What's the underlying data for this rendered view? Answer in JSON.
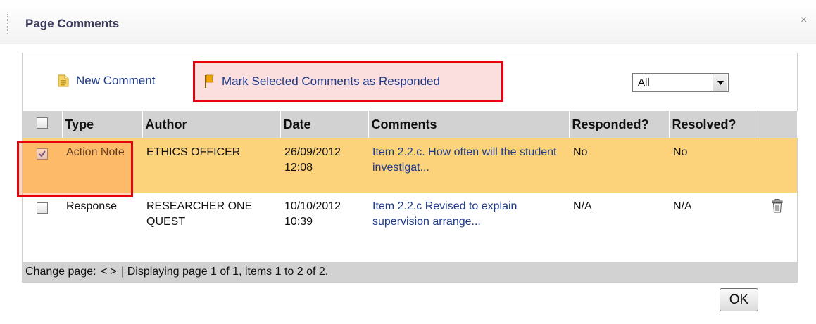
{
  "dialog": {
    "title": "Page Comments",
    "close_glyph": "×"
  },
  "toolbar": {
    "new_comment_label": "New Comment",
    "mark_responded_label": "Mark Selected Comments as Responded",
    "filter": {
      "selected": "All"
    }
  },
  "table": {
    "columns": [
      "Type",
      "Author",
      "Date",
      "Comments",
      "Responded?",
      "Resolved?"
    ],
    "rows": [
      {
        "checked": true,
        "type": "Action Note",
        "author": "ETHICS OFFICER",
        "date": "26/09/2012 12:08",
        "comment": "Item 2.2.c. How often will the student investigat...",
        "responded": "No",
        "resolved": "No",
        "has_delete": false
      },
      {
        "checked": false,
        "type": "Response",
        "author": "RESEARCHER ONE QUEST",
        "date": "10/10/2012 10:39",
        "comment": "Item 2.2.c Revised to explain supervision arrange...",
        "responded": "N/A",
        "resolved": "N/A",
        "has_delete": true
      }
    ]
  },
  "pager": {
    "prefix": "Change page:",
    "prev": "<",
    "next": ">",
    "separator": "|",
    "status": "Displaying page 1 of 1, items 1 to 2 of 2."
  },
  "ok_label": "OK",
  "colors": {
    "highlight_red": "#e8000d",
    "selected_row": "#fcd37b",
    "link_blue": "#1e3a8a",
    "header_gray": "#d2d2d2"
  },
  "icons": [
    "grip-handle",
    "close-icon",
    "new-comment-icon",
    "flag-icon",
    "dropdown-arrow-icon",
    "checkbox",
    "checkmark-icon",
    "trash-icon"
  ]
}
